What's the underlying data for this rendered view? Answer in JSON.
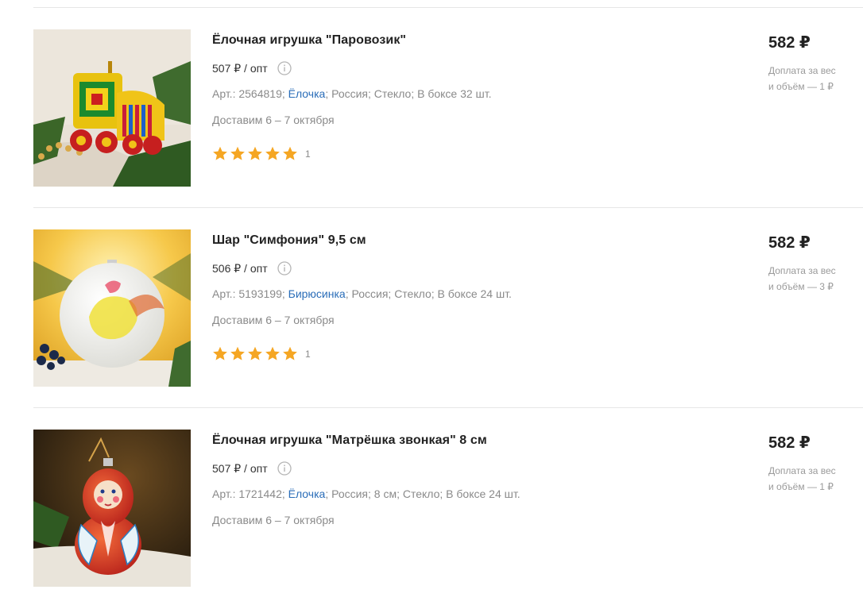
{
  "products": [
    {
      "title": "Ёлочная игрушка \"Паровозик\"",
      "wholesale": "507 ₽ / опт",
      "sku": "Арт.: 2564819;",
      "brand": "Ёлочка",
      "details": "; Россия; Стекло; В боксе 32 шт.",
      "delivery": "Доставим 6 – 7 октября",
      "rating": 5,
      "reviews": "1",
      "price": "582 ₽",
      "surcharge_line1": "Доплата за вес",
      "surcharge_line2": "и объём — 1 ₽",
      "image_icon": "train-ornament-image"
    },
    {
      "title": "Шар \"Симфония\" 9,5 см",
      "wholesale": "506 ₽ / опт",
      "sku": "Арт.: 5193199;",
      "brand": "Бирюсинка",
      "details": "; Россия; Стекло; В боксе 24 шт.",
      "delivery": "Доставим 6 – 7 октября",
      "rating": 5,
      "reviews": "1",
      "price": "582 ₽",
      "surcharge_line1": "Доплата за вес",
      "surcharge_line2": "и объём — 3 ₽",
      "image_icon": "bird-ball-ornament-image"
    },
    {
      "title": "Ёлочная игрушка \"Матрёшка звонкая\" 8 см",
      "wholesale": "507 ₽ / опт",
      "sku": "Арт.: 1721442;",
      "brand": "Ёлочка",
      "details": "; Россия; 8 см; Стекло; В боксе 24 шт.",
      "delivery": "Доставим 6 – 7 октября",
      "price": "582 ₽",
      "surcharge_line1": "Доплата за вес",
      "surcharge_line2": "и объём — 1 ₽",
      "image_icon": "matryoshka-ornament-image"
    }
  ],
  "colors": {
    "star": "#f5a623",
    "link": "#2a6db8",
    "muted": "#8a8a8a",
    "divider": "#e6e6e6"
  }
}
